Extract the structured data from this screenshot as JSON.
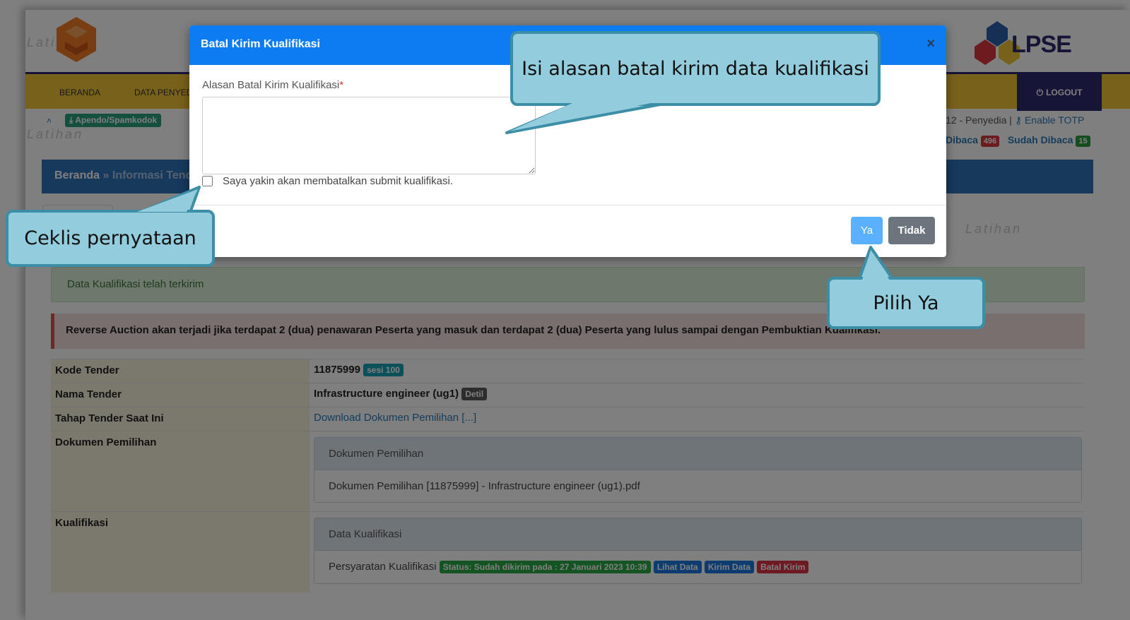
{
  "watermark": "Latihan",
  "header": {
    "logo_right_text": "LPSE",
    "nav": [
      "BERANDA",
      "DATA PENYEDIA"
    ],
    "logout_label": "LOGOUT"
  },
  "util": {
    "apendo_label": "Apendo/Spamkodok",
    "user_text": "12 - Penyedia |",
    "enable_totp": "Enable TOTP",
    "belum_dibaca": "Dibaca",
    "belum_count": "496",
    "sudah_dibaca": "Sudah Dibaca",
    "sudah_count": "15"
  },
  "breadcrumb": {
    "home": "Beranda",
    "sep": "»",
    "current": "Informasi Tender"
  },
  "alerts": {
    "success": "Data Kualifikasi telah terkirim",
    "warning": "Reverse Auction akan terjadi jika terdapat 2 (dua) penawaran Peserta yang masuk dan terdapat 2 (dua) Peserta yang lulus sampai dengan Pembuktian Kualifikasi."
  },
  "table": {
    "kode_label": "Kode Tender",
    "kode_value": "11875999",
    "kode_badge": "sesi 100",
    "nama_label": "Nama Tender",
    "nama_value": "Infrastructure engineer (ug1)",
    "nama_badge": "Detil",
    "tahap_label": "Tahap Tender Saat Ini",
    "tahap_value": "Download Dokumen Pemilihan [...]",
    "dokumen_label": "Dokumen Pemilihan",
    "dokumen_panel_title": "Dokumen Pemilihan",
    "dokumen_file": "Dokumen Pemilihan [11875999] - Infrastructure engineer (ug1).pdf",
    "kualifikasi_label": "Kualifikasi",
    "kualifikasi_panel_title": "Data Kualifikasi",
    "persyaratan": "Persyaratan Kualifikasi",
    "status_badge": "Status: Sudah dikirim pada : 27 Januari 2023 10:39",
    "lihat": "Lihat Data",
    "kirim": "Kirim Data",
    "batal": "Batal Kirim"
  },
  "modal": {
    "title": "Batal Kirim Kualifikasi",
    "close": "×",
    "reason_label": "Alasan Batal Kirim Kualifikasi",
    "required_mark": "*",
    "reason_value": "",
    "confirm_text": "Saya yakin akan membatalkan submit kualifikasi.",
    "confirm_checked": false,
    "yes_label": "Ya",
    "no_label": "Tidak"
  },
  "callouts": {
    "reason": "Isi alasan batal kirim data kualifikasi",
    "checkbox": "Ceklis pernyataan",
    "yes": "Pilih Ya"
  },
  "colors": {
    "modal_header": "#0d7cf2",
    "callout_fill": "#93cddd",
    "callout_border": "#3c8ea6",
    "nav_bar": "#f0c237"
  }
}
